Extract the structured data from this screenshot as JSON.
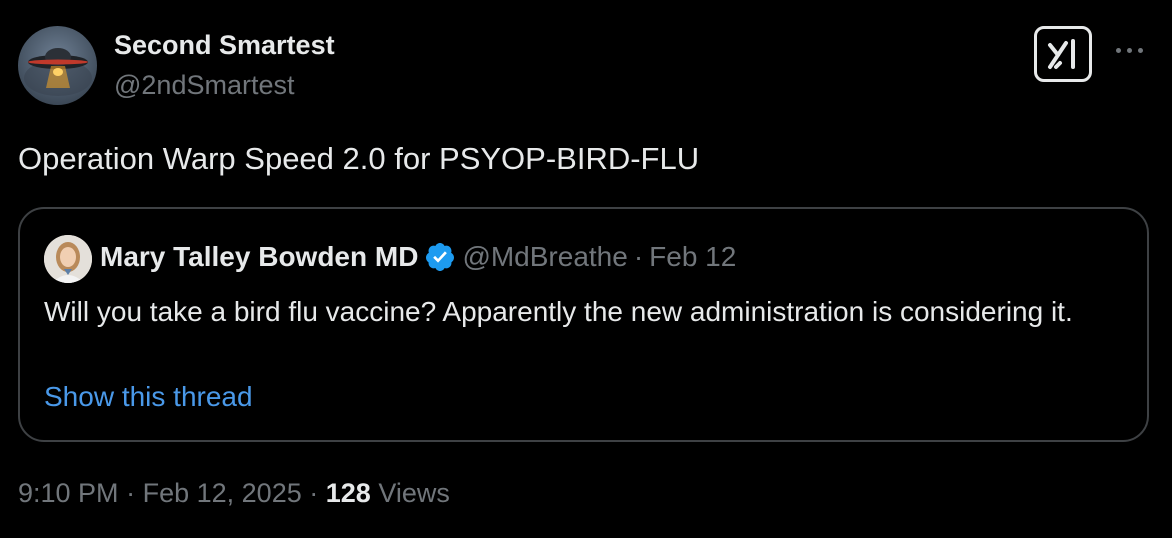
{
  "author": {
    "name": "Second Smartest",
    "handle": "@2ndSmartest"
  },
  "header_actions": {
    "grok_icon": "grok-icon",
    "more_icon": "more-horizontal-icon"
  },
  "tweet": {
    "text": "Operation Warp Speed 2.0 for PSYOP-BIRD-FLU"
  },
  "quoted_tweet": {
    "author_name": "Mary Talley Bowden MD",
    "verified_icon": "verified-badge-icon",
    "handle": "@MdBreathe",
    "separator": "·",
    "date": "Feb 12",
    "text": "Will you take a bird flu vaccine?  Apparently the new administration is considering it.",
    "show_thread_label": "Show this thread"
  },
  "meta": {
    "time": "9:10 PM",
    "separator": "·",
    "date": "Feb 12, 2025",
    "views_count": "128",
    "views_label": "Views"
  },
  "colors": {
    "background": "#000000",
    "primary_text": "#e7e9ea",
    "secondary_text": "#71767b",
    "link": "#4a99e9",
    "verified": "#1d9bf0",
    "card_border": "#3e4144"
  }
}
